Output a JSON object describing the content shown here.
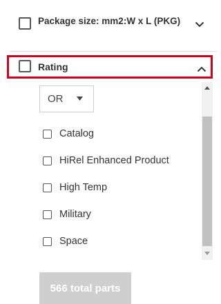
{
  "package_filter": {
    "label": "Package size: mm2:W x L (PKG)",
    "chevron_icon": "chevron-down-icon"
  },
  "rating_filter": {
    "label": "Rating",
    "chevron_icon": "chevron-up-icon",
    "highlight_color": "#d0021b",
    "logic_select": {
      "value": "OR",
      "arrow_icon": "caret-down-icon"
    },
    "options": [
      {
        "label": "Catalog",
        "checked": false
      },
      {
        "label": "HiRel Enhanced Product",
        "checked": false
      },
      {
        "label": "High Temp",
        "checked": false
      },
      {
        "label": "Military",
        "checked": false
      },
      {
        "label": "Space",
        "checked": false
      }
    ]
  },
  "total_parts_button": {
    "label": "566 total parts",
    "background": "#cfcfcf"
  }
}
